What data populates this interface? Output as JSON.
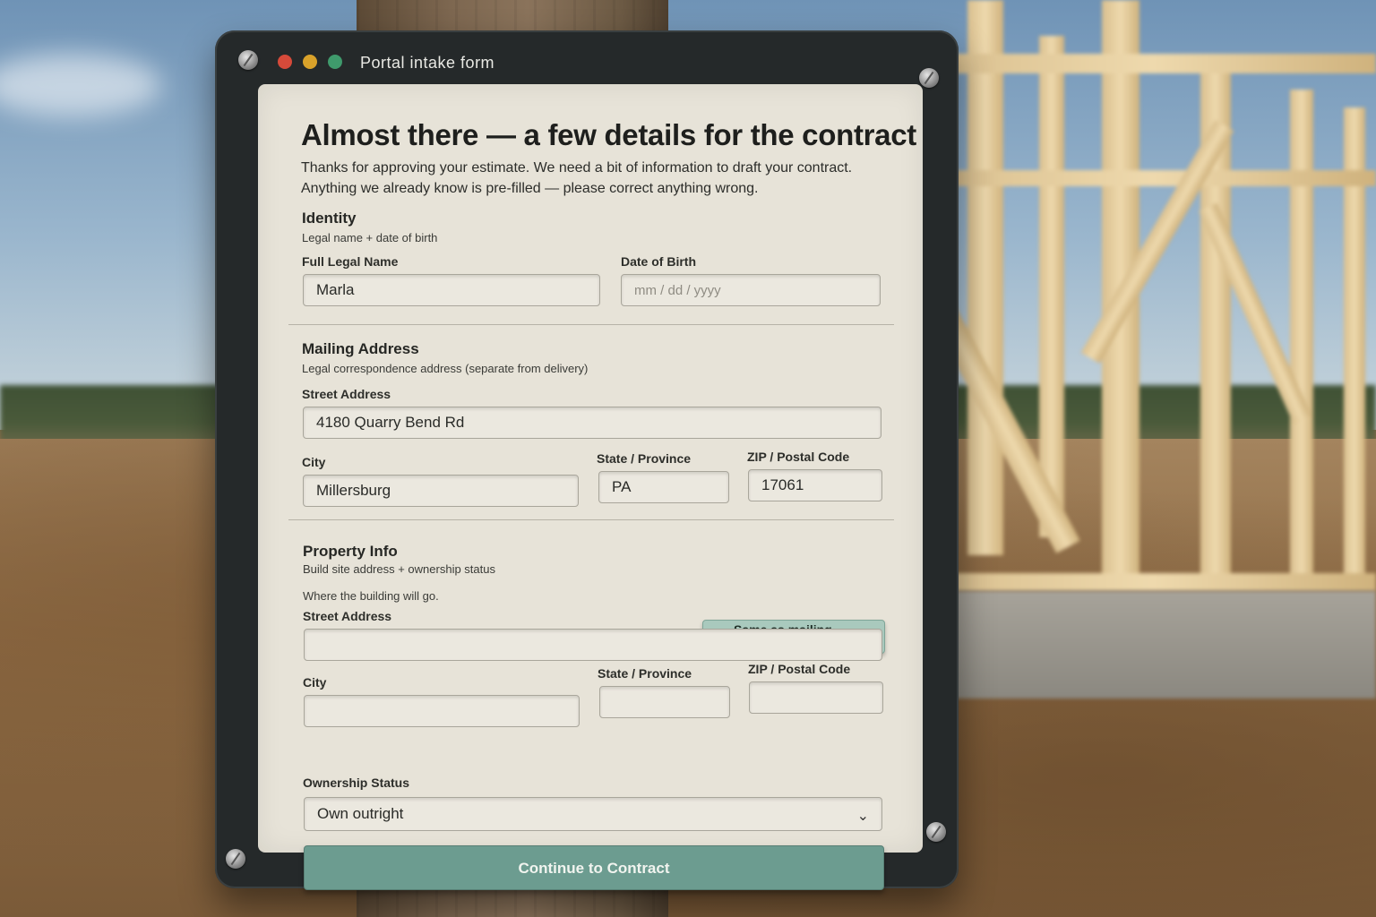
{
  "window": {
    "title": "Portal intake form",
    "traffic_light_colors": [
      "#d64a3a",
      "#d9a22a",
      "#3f9a6c"
    ]
  },
  "form": {
    "title": "Almost there — a few details for the contract",
    "intro_line1": "Thanks for approving your estimate. We need a bit of information to draft your contract.",
    "intro_line2": "Anything we already know is pre-filled — please correct anything wrong."
  },
  "identity": {
    "title": "Identity",
    "subtitle": "Legal name + date of birth",
    "full_name_label": "Full Legal Name",
    "full_name_value": "Marla",
    "dob_label": "Date of Birth",
    "dob_placeholder": "mm / dd / yyyy"
  },
  "mailing": {
    "title": "Mailing Address",
    "subtitle": "Legal correspondence address (separate from delivery)",
    "street_label": "Street Address",
    "street_value": "4180 Quarry Bend Rd",
    "city_label": "City",
    "city_value": "Millersburg",
    "state_label": "State / Province",
    "state_value": "PA",
    "zip_label": "ZIP / Postal Code",
    "zip_value": "17061"
  },
  "property": {
    "title": "Property Info",
    "subtitle": "Build site address + ownership status",
    "hint": "Where the building will go.",
    "same_button": "Same as mailing address",
    "street_label": "Street Address",
    "city_label": "City",
    "state_label": "State / Province",
    "zip_label": "ZIP / Postal Code",
    "ownership_label": "Ownership Status",
    "ownership_value": "Own outright"
  },
  "actions": {
    "continue": "Continue to Contract"
  },
  "colors": {
    "accent": "#6c9c90",
    "secondary_button": "#a9c9bd",
    "panel": "#e7e3d8",
    "frame": "#25292a"
  }
}
